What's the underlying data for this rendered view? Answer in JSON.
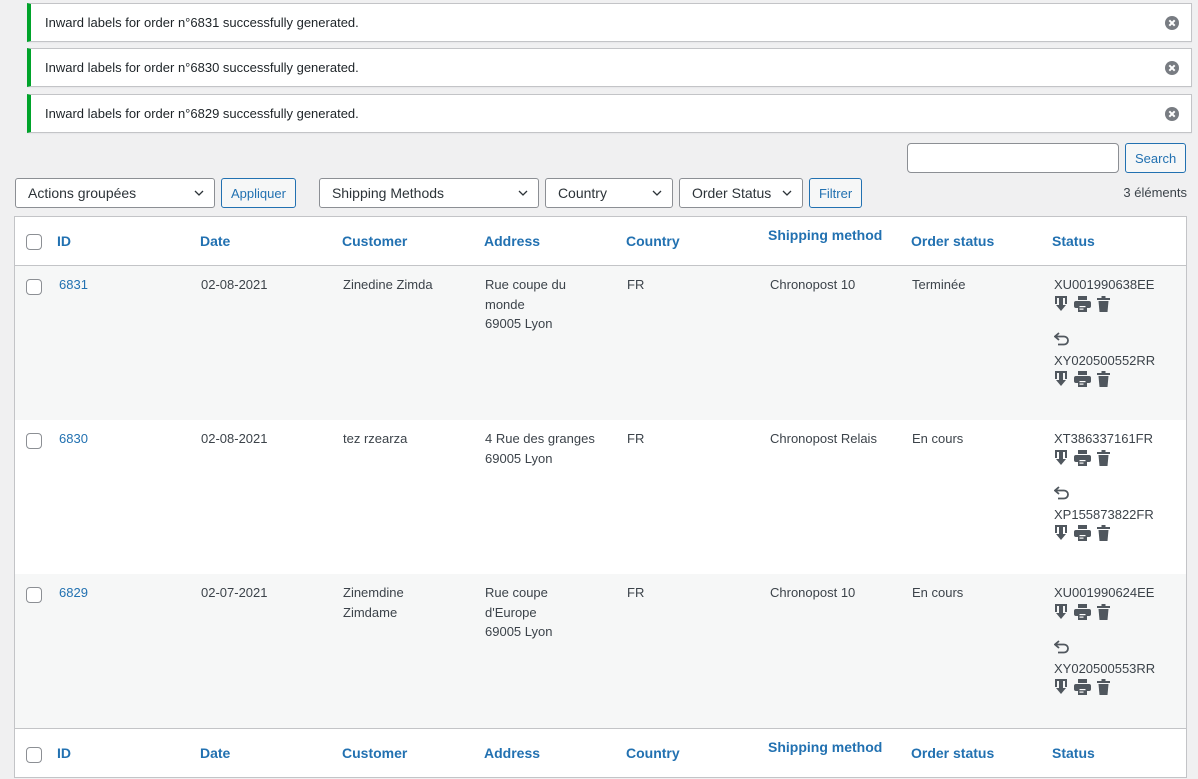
{
  "notices": [
    {
      "message": "Inward labels for order n°6831 successfully generated."
    },
    {
      "message": "Inward labels for order n°6830 successfully generated."
    },
    {
      "message": "Inward labels for order n°6829 successfully generated."
    }
  ],
  "search": {
    "value": "",
    "placeholder": "",
    "button_label": "Search"
  },
  "toolbar": {
    "bulk_actions": "Actions groupées",
    "apply_label": "Appliquer",
    "shipping_methods": "Shipping Methods",
    "country": "Country",
    "order_status": "Order Status",
    "filter_label": "Filtrer"
  },
  "item_count": "3 éléments",
  "columns": {
    "id": "ID",
    "date": "Date",
    "customer": "Customer",
    "address": "Address",
    "country": "Country",
    "shipping_method": "Shipping method",
    "order_status": "Order status",
    "status": "Status"
  },
  "rows": [
    {
      "id": "6831",
      "date": "02-08-2021",
      "customer": "Zinedine Zimda",
      "address_line1": "Rue coupe du",
      "address_line2": "monde",
      "address_city": "69005 Lyon",
      "country": "FR",
      "shipping_method": "Chronopost 10",
      "order_status": "Terminée",
      "tracking": "XU001990638EE",
      "return_tracking": "XY020500552RR"
    },
    {
      "id": "6830",
      "date": "02-08-2021",
      "customer": "tez rzearza",
      "address_line1": "4 Rue des granges",
      "address_line2": "",
      "address_city": "69005 Lyon",
      "country": "FR",
      "shipping_method": "Chronopost Relais",
      "order_status": "En cours",
      "tracking": "XT386337161FR",
      "return_tracking": "XP155873822FR"
    },
    {
      "id": "6829",
      "date": "02-07-2021",
      "customer": "Zinemdine Zimdame",
      "address_line1": "Rue coupe",
      "address_line2": "d'Europe",
      "address_city": "69005 Lyon",
      "country": "FR",
      "shipping_method": "Chronopost 10",
      "order_status": "En cours",
      "tracking": "XU001990624EE",
      "return_tracking": "XY020500553RR"
    }
  ],
  "colors": {
    "accent": "#2271b1",
    "success": "#00a32a",
    "icon": "#50575e"
  }
}
